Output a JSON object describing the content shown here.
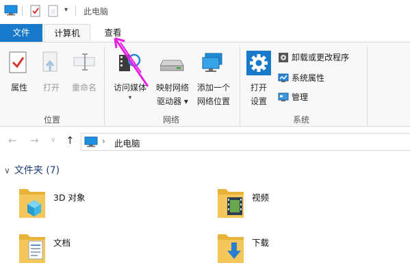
{
  "titlebar": {
    "path_title": "此电脑"
  },
  "tabs": [
    {
      "label": "文件"
    },
    {
      "label": "计算机"
    },
    {
      "label": "查看"
    }
  ],
  "ribbon": {
    "location_group": {
      "label": "位置",
      "buttons": [
        {
          "label": "属性"
        },
        {
          "label": "打开"
        },
        {
          "label": "重命名"
        }
      ]
    },
    "network_group": {
      "label": "网络",
      "buttons": [
        {
          "label": "访问媒体"
        },
        {
          "label_line1": "映射网络",
          "label_line2": "驱动器 ▾"
        },
        {
          "label_line1": "添加一个",
          "label_line2": "网络位置"
        }
      ]
    },
    "system_group": {
      "label": "系统",
      "open_settings": {
        "label_line1": "打开",
        "label_line2": "设置"
      },
      "small_buttons": [
        {
          "label": "卸载或更改程序"
        },
        {
          "label": "系统属性"
        },
        {
          "label": "管理"
        }
      ]
    }
  },
  "address": {
    "location": "此电脑"
  },
  "content": {
    "section": "文件夹 (7)",
    "folders": [
      {
        "name": "3D 对象"
      },
      {
        "name": "视频"
      },
      {
        "name": "文档"
      },
      {
        "name": "下载"
      }
    ]
  },
  "colors": {
    "accent": "#1979ca",
    "annotation": "#e91ee6",
    "folder": "#f3c75a"
  }
}
